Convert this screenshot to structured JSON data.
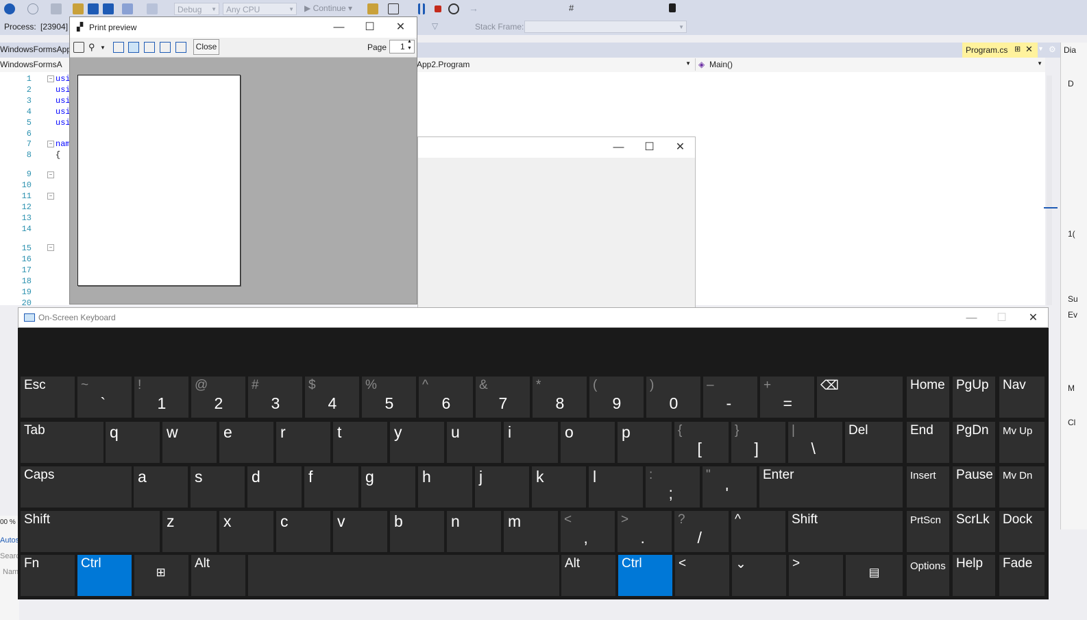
{
  "vs": {
    "toolbar": {
      "config": "Debug",
      "platform": "Any CPU",
      "continue": "Continue"
    },
    "toolbar2": {
      "process_label": "Process:",
      "process_value": "[23904]",
      "stack_frame_label": "Stack Frame:"
    },
    "solution_tab": "WindowsFormsApp",
    "solution_nav": "WindowsFormsA",
    "editor_tab": "Program.cs",
    "nav_class": "App2.Program",
    "nav_member": "Main()",
    "line_numbers": [
      "1",
      "2",
      "3",
      "4",
      "5",
      "6",
      "7",
      "8",
      "9",
      "10",
      "11",
      "12",
      "13",
      "14",
      "15",
      "16",
      "17",
      "18",
      "19",
      "20"
    ],
    "code": {
      "l1": "usi",
      "l2": "usi",
      "l3": "usi",
      "l4": "usi",
      "l5": "usi",
      "l7": "nam",
      "l8": "{"
    },
    "zoom": "00 %",
    "autos": "Autos",
    "search": "Searc",
    "name_col": "Nam",
    "right_panel": {
      "diag": "Dia",
      "d": "D",
      "su": "Su",
      "ev": "Ev",
      "m": "M",
      "c": "Cl",
      "one": "1("
    }
  },
  "print_preview": {
    "title": "Print preview",
    "close_label": "Close",
    "page_label": "Page",
    "page_value": "1"
  },
  "osk": {
    "title": "On-Screen Keyboard",
    "rows": [
      [
        {
          "k": "esc",
          "main": "Esc",
          "type": "label"
        },
        {
          "k": "backtick",
          "shift": "~",
          "main": "`"
        },
        {
          "k": "1",
          "shift": "!",
          "main": "1"
        },
        {
          "k": "2",
          "shift": "@",
          "main": "2"
        },
        {
          "k": "3",
          "shift": "#",
          "main": "3"
        },
        {
          "k": "4",
          "shift": "$",
          "main": "4"
        },
        {
          "k": "5",
          "shift": "%",
          "main": "5"
        },
        {
          "k": "6",
          "shift": "^",
          "main": "6"
        },
        {
          "k": "7",
          "shift": "&",
          "main": "7"
        },
        {
          "k": "8",
          "shift": "*",
          "main": "8"
        },
        {
          "k": "9",
          "shift": "(",
          "main": "9"
        },
        {
          "k": "0",
          "shift": ")",
          "main": "0"
        },
        {
          "k": "minus",
          "shift": "–",
          "main": "-"
        },
        {
          "k": "equals",
          "shift": "+",
          "main": "="
        },
        {
          "k": "backspace",
          "main": "⌫",
          "type": "label"
        }
      ],
      [
        {
          "k": "tab",
          "main": "Tab",
          "type": "label"
        },
        {
          "k": "q",
          "main": "q",
          "type": "letter"
        },
        {
          "k": "w",
          "main": "w",
          "type": "letter"
        },
        {
          "k": "e",
          "main": "e",
          "type": "letter"
        },
        {
          "k": "r",
          "main": "r",
          "type": "letter"
        },
        {
          "k": "t",
          "main": "t",
          "type": "letter"
        },
        {
          "k": "y",
          "main": "y",
          "type": "letter"
        },
        {
          "k": "u",
          "main": "u",
          "type": "letter"
        },
        {
          "k": "i",
          "main": "i",
          "type": "letter"
        },
        {
          "k": "o",
          "main": "o",
          "type": "letter"
        },
        {
          "k": "p",
          "main": "p",
          "type": "letter"
        },
        {
          "k": "lbracket",
          "shift": "{",
          "main": "["
        },
        {
          "k": "rbracket",
          "shift": "}",
          "main": "]"
        },
        {
          "k": "backslash",
          "shift": "|",
          "main": "\\"
        },
        {
          "k": "del",
          "main": "Del",
          "type": "label"
        }
      ],
      [
        {
          "k": "caps",
          "main": "Caps",
          "type": "label"
        },
        {
          "k": "a",
          "main": "a",
          "type": "letter"
        },
        {
          "k": "s",
          "main": "s",
          "type": "letter"
        },
        {
          "k": "d",
          "main": "d",
          "type": "letter"
        },
        {
          "k": "f",
          "main": "f",
          "type": "letter"
        },
        {
          "k": "g",
          "main": "g",
          "type": "letter"
        },
        {
          "k": "h",
          "main": "h",
          "type": "letter"
        },
        {
          "k": "j",
          "main": "j",
          "type": "letter"
        },
        {
          "k": "k",
          "main": "k",
          "type": "letter"
        },
        {
          "k": "l",
          "main": "l",
          "type": "letter"
        },
        {
          "k": "semicolon",
          "shift": ":",
          "main": ";"
        },
        {
          "k": "quote",
          "shift": "\"",
          "main": "'"
        },
        {
          "k": "enter",
          "main": "Enter",
          "type": "label"
        }
      ],
      [
        {
          "k": "lshift",
          "main": "Shift",
          "type": "label"
        },
        {
          "k": "z",
          "main": "z",
          "type": "letter"
        },
        {
          "k": "x",
          "main": "x",
          "type": "letter"
        },
        {
          "k": "c",
          "main": "c",
          "type": "letter"
        },
        {
          "k": "v",
          "main": "v",
          "type": "letter"
        },
        {
          "k": "b",
          "main": "b",
          "type": "letter"
        },
        {
          "k": "n",
          "main": "n",
          "type": "letter"
        },
        {
          "k": "m",
          "main": "m",
          "type": "letter"
        },
        {
          "k": "comma",
          "shift": "<",
          "main": ","
        },
        {
          "k": "period",
          "shift": ">",
          "main": "."
        },
        {
          "k": "slash",
          "shift": "?",
          "main": "/"
        },
        {
          "k": "up",
          "main": "^",
          "type": "label"
        },
        {
          "k": "rshift",
          "main": "Shift",
          "type": "label"
        }
      ],
      [
        {
          "k": "fn",
          "main": "Fn",
          "type": "label"
        },
        {
          "k": "lctrl",
          "main": "Ctrl",
          "type": "label",
          "active": true
        },
        {
          "k": "win",
          "main": "⊞",
          "type": "icon"
        },
        {
          "k": "lalt",
          "main": "Alt",
          "type": "label"
        },
        {
          "k": "space",
          "main": "",
          "type": "label"
        },
        {
          "k": "ralt",
          "main": "Alt",
          "type": "label"
        },
        {
          "k": "rctrl",
          "main": "Ctrl",
          "type": "label",
          "active": true
        },
        {
          "k": "left",
          "main": "<",
          "type": "label"
        },
        {
          "k": "down",
          "main": "⌄",
          "type": "label"
        },
        {
          "k": "right",
          "main": ">",
          "type": "label"
        },
        {
          "k": "menu",
          "main": "▤",
          "type": "icon"
        }
      ]
    ],
    "side": [
      [
        "Home",
        "PgUp",
        "Nav"
      ],
      [
        "End",
        "PgDn",
        "Mv Up"
      ],
      [
        "Insert",
        "Pause",
        "Mv Dn"
      ],
      [
        "PrtScn",
        "ScrLk",
        "Dock"
      ],
      [
        "Options",
        "Help",
        "Fade"
      ]
    ]
  }
}
